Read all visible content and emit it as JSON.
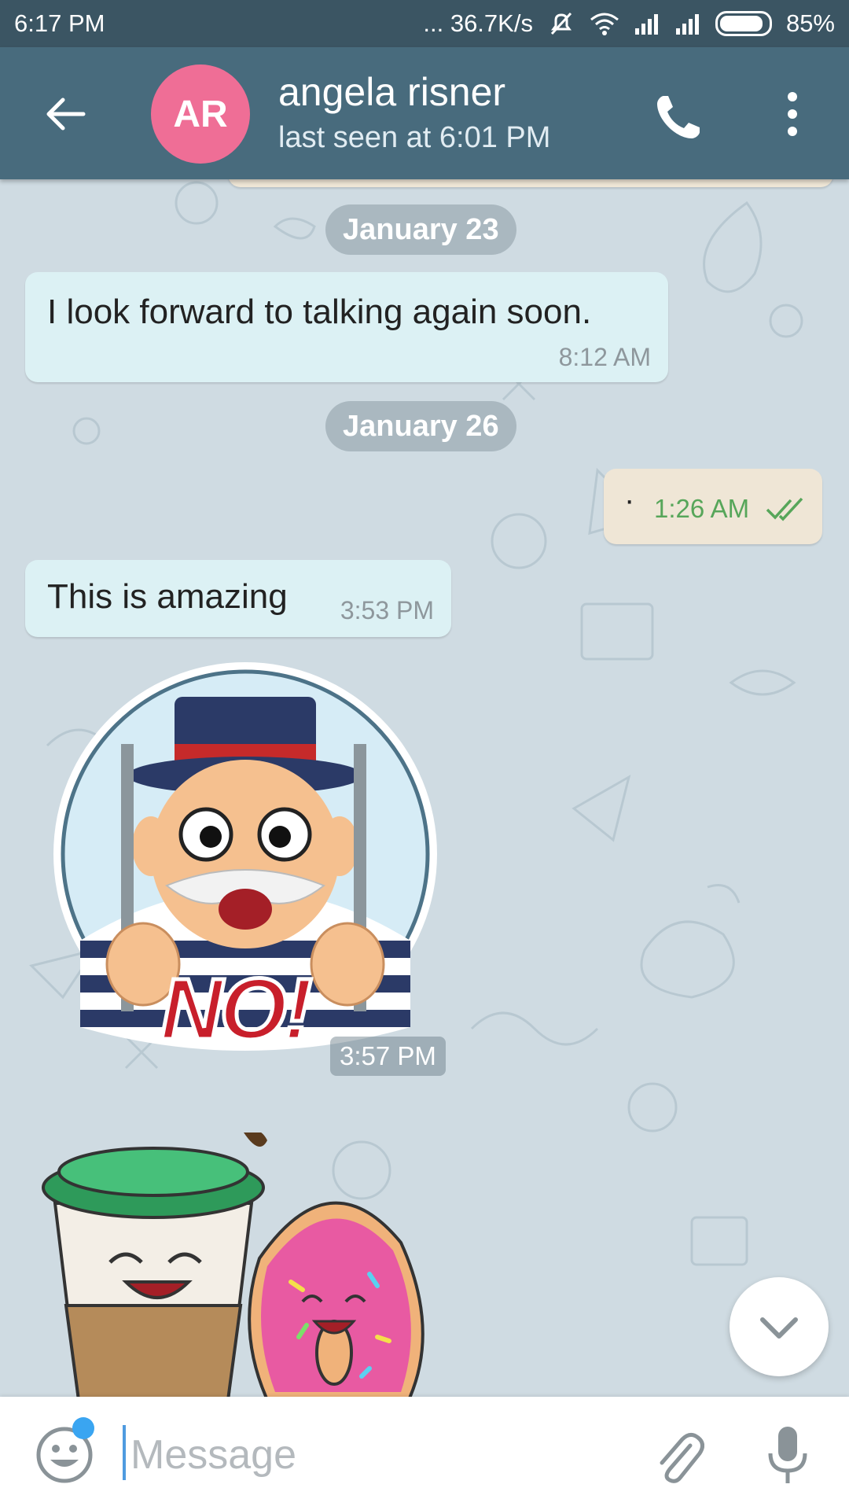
{
  "status_bar": {
    "time": "6:17 PM",
    "net_speed": "... 36.7K/s",
    "battery": "85%"
  },
  "header": {
    "avatar_initials": "AR",
    "avatar_color": "#ef6e96",
    "contact_name": "angela risner",
    "contact_status": "last seen at 6:01 PM"
  },
  "chat": {
    "dates": [
      "January 23",
      "January 26"
    ],
    "messages": [
      {
        "direction": "in",
        "text": "I look forward to talking again soon.",
        "time": "8:12 AM"
      },
      {
        "direction": "out",
        "text": "·",
        "time": "1:26 AM",
        "read": true
      },
      {
        "direction": "in",
        "text": "This is amazing",
        "time": "3:53 PM"
      },
      {
        "direction": "in",
        "type": "sticker",
        "sticker_text": "NO!",
        "time": "3:57 PM"
      },
      {
        "direction": "in",
        "type": "sticker",
        "sticker": "coffee cup and donut"
      }
    ]
  },
  "composer": {
    "placeholder": "Message"
  },
  "colors": {
    "header": "#486b7d",
    "status_bar": "#3b5563",
    "incoming_bubble": "#dcf1f4",
    "outgoing_bubble": "#efe6d6",
    "read_check": "#57a65a",
    "notification_dot": "#3aa5f1"
  }
}
